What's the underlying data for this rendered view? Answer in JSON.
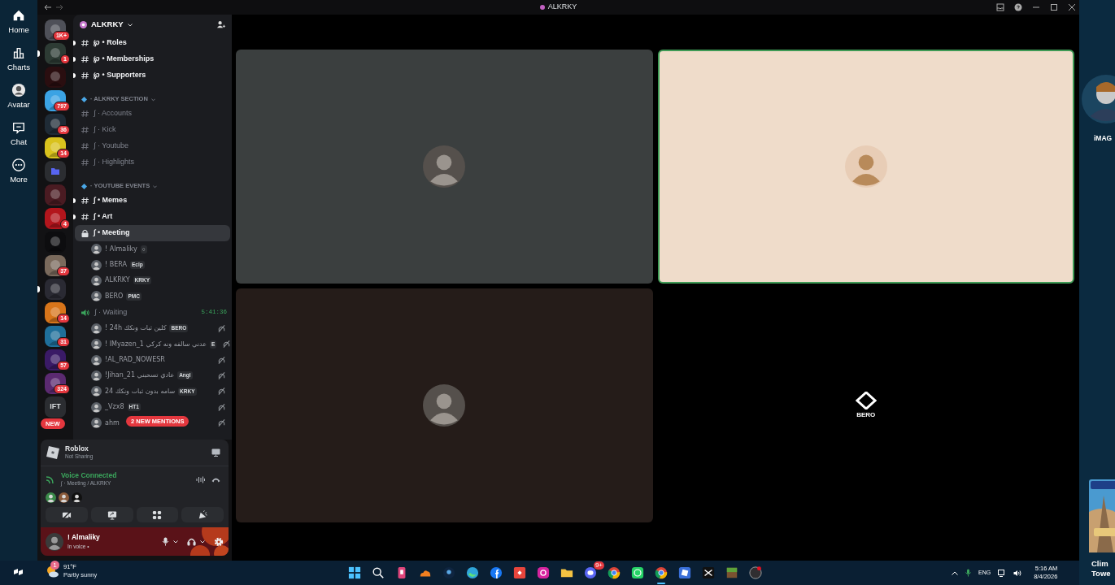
{
  "launcher_nav": [
    {
      "kind": "home",
      "label": "Home"
    },
    {
      "kind": "charts",
      "label": "Charts"
    },
    {
      "kind": "avatar",
      "label": "Avatar"
    },
    {
      "kind": "chat",
      "label": "Chat"
    },
    {
      "kind": "more",
      "label": "More"
    }
  ],
  "window": {
    "title": "ALKRKY"
  },
  "servers": [
    {
      "kind": "server",
      "color": "#4e5058",
      "badge": "1K+",
      "unread": false
    },
    {
      "kind": "server",
      "color": "#2d3b34",
      "badge": "1",
      "unread": true
    },
    {
      "kind": "server",
      "color": "#2a0e10",
      "unread": false
    },
    {
      "kind": "server",
      "color": "#3ba3e4",
      "badge": "797",
      "unread": false
    },
    {
      "kind": "server",
      "color": "#1f2b36",
      "badge": "36",
      "unread": false
    },
    {
      "kind": "server",
      "color": "#d9c21d",
      "badge": "14",
      "unread": false
    },
    {
      "kind": "folder",
      "unread": false
    },
    {
      "kind": "server",
      "color": "#4a1b22",
      "unread": false
    },
    {
      "kind": "server",
      "color": "#b3151c",
      "badge": "4",
      "unread": false
    },
    {
      "kind": "server",
      "color": "#0d0d0f",
      "unread": false
    },
    {
      "kind": "server",
      "color": "#7a6a5c",
      "badge": "37",
      "unread": false
    },
    {
      "kind": "server",
      "color": "#2a2a33",
      "unread": true
    },
    {
      "kind": "server",
      "color": "#d8751a",
      "badge": "14",
      "unread": false
    },
    {
      "kind": "server",
      "color": "#1f6f9a",
      "badge": "31",
      "unread": false
    },
    {
      "kind": "server",
      "color": "#3a1a66",
      "badge": "57",
      "unread": false
    },
    {
      "kind": "server",
      "color": "#5b2a70",
      "badge": "324",
      "unread": false
    },
    {
      "kind": "text",
      "label": "IFT",
      "unread": false
    }
  ],
  "new_pill": "NEW",
  "mentions_pill": "2 NEW MENTIONS",
  "server_header": {
    "name": "ALKRKY"
  },
  "channels": [
    {
      "kind": "text",
      "name": "℘ • Roles",
      "unread": true,
      "selected": false
    },
    {
      "kind": "text",
      "name": "℘ • Memberships",
      "unread": true,
      "selected": false
    },
    {
      "kind": "text",
      "name": "℘ • Supporters",
      "unread": true,
      "selected": false
    },
    {
      "kind": "category",
      "name": "· ALKRKY SECTION"
    },
    {
      "kind": "text",
      "name": "∫ · Accounts",
      "unread": false,
      "selected": false
    },
    {
      "kind": "text",
      "name": "∫ · Kick",
      "unread": false,
      "selected": false
    },
    {
      "kind": "text",
      "name": "∫ · Youtube",
      "unread": false,
      "selected": false
    },
    {
      "kind": "text",
      "name": "∫ · Highlights",
      "unread": false,
      "selected": false
    },
    {
      "kind": "category",
      "name": "· YOUTUBE EVENTS"
    },
    {
      "kind": "text",
      "name": "∫ • Memes",
      "unread": true,
      "selected": false
    },
    {
      "kind": "text",
      "name": "∫ • Art",
      "unread": true,
      "selected": false
    },
    {
      "kind": "voice",
      "name": "∫ • Meeting",
      "locked": true,
      "selected": true,
      "members": [
        {
          "name": "! Almaliky",
          "tag": "○",
          "deafened": false
        },
        {
          "name": "! BERA",
          "tag": "Eclp",
          "deafened": false
        },
        {
          "name": "ALKRKY",
          "tag": "KRKY",
          "deafened": false
        },
        {
          "name": "BERO",
          "tag": "PMC",
          "deafened": false
        }
      ]
    },
    {
      "kind": "voice",
      "name": "∫ · Waiting",
      "locked": false,
      "selected": false,
      "timer": "5:41:36",
      "members": [
        {
          "name": "! 24h كلين ثبات ونكك",
          "tag": "BERO",
          "deafened": true
        },
        {
          "name": "! IMyazen_1 عدني سالفه ونه كركي",
          "tag": "E",
          "deafened": true
        },
        {
          "name": "!AL_RAD_NOWESR",
          "deafened": true
        },
        {
          "name": "!Jihan_21 عادي تسحبني",
          "tag": "Angl",
          "deafened": true
        },
        {
          "name": "24 سامه بدون ثبات ونكك",
          "tag": "KRKY",
          "deafened": true
        },
        {
          "name": "_Vzx8",
          "tag": "HT1",
          "deafened": true
        },
        {
          "name": "ahm",
          "deafened": true
        }
      ]
    }
  ],
  "activity": {
    "title": "Roblox",
    "subtitle": "Not Sharing"
  },
  "voice": {
    "status": "Voice Connected",
    "channel": "∫ · Meeting / ALKRKY",
    "participants": [
      {
        "color": "#3b8a4a"
      },
      {
        "color": "#8a5a3a"
      },
      {
        "color": "#101010"
      }
    ]
  },
  "user": {
    "name": "! Almaliky",
    "status": "In voice •"
  },
  "video_tiles": [
    {
      "kind": "avatar",
      "color": "#3b3f3f",
      "speaking": false
    },
    {
      "kind": "avatar",
      "color": "#efdcca",
      "speaking": true
    },
    {
      "kind": "avatar",
      "color": "#251c19",
      "speaking": false
    },
    {
      "kind": "logo",
      "color": "#000000",
      "label": "BERO",
      "speaking": false
    }
  ],
  "side_panel": {
    "friend": "iMAG",
    "game_lines": [
      "Clim",
      "Towe"
    ]
  },
  "taskbar": {
    "weather": {
      "temp": "91°F",
      "condition": "Partly sunny",
      "badge": "1"
    },
    "apps": [
      {
        "kind": "windows",
        "selected": false
      },
      {
        "kind": "search",
        "selected": false
      },
      {
        "kind": "pink",
        "selected": false
      },
      {
        "kind": "cloud",
        "selected": false
      },
      {
        "kind": "navy",
        "selected": false
      },
      {
        "kind": "edge",
        "selected": false
      },
      {
        "kind": "facebook",
        "selected": false
      },
      {
        "kind": "red",
        "selected": false
      },
      {
        "kind": "instagram",
        "selected": false
      },
      {
        "kind": "folder",
        "selected": false
      },
      {
        "kind": "discord",
        "badge": "9+",
        "selected": false
      },
      {
        "kind": "chrome",
        "selected": false
      },
      {
        "kind": "whatsapp",
        "selected": false
      },
      {
        "kind": "chrome",
        "selected": true
      },
      {
        "kind": "roblox",
        "selected": false
      },
      {
        "kind": "black",
        "selected": false
      },
      {
        "kind": "grass",
        "selected": false
      },
      {
        "kind": "obs",
        "selected": false
      }
    ],
    "tray": {
      "language": "ENG",
      "time": "5:16 AM",
      "date": "8/4/2026"
    }
  }
}
